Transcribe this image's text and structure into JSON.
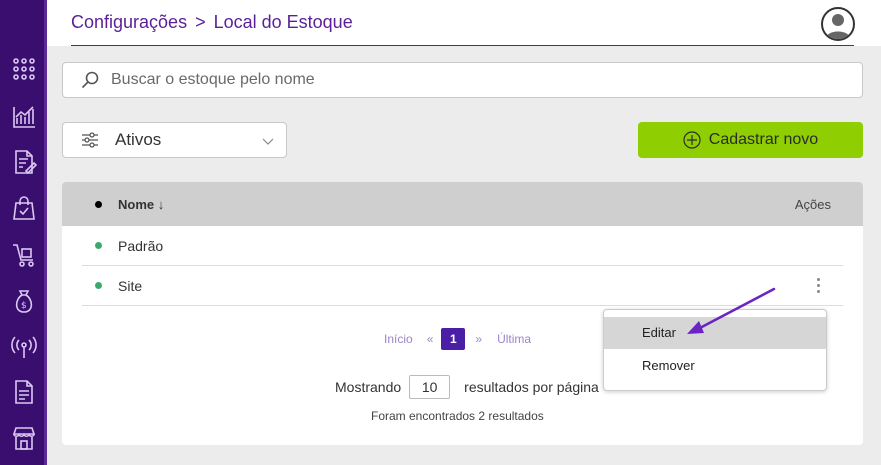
{
  "breadcrumb": {
    "parent": "Configurações",
    "separator": ">",
    "current": "Local do Estoque"
  },
  "search": {
    "placeholder": "Buscar o estoque pelo nome",
    "value": ""
  },
  "filter": {
    "selected": "Ativos"
  },
  "actions": {
    "new_label": "Cadastrar novo"
  },
  "table": {
    "col_name": "Nome",
    "sort_indicator": "↓",
    "col_actions": "Ações",
    "rows": [
      {
        "name": "Padrão",
        "status_color": "#3aaa6f"
      },
      {
        "name": "Site",
        "status_color": "#3aaa6f"
      }
    ]
  },
  "pagination": {
    "first": "Início",
    "prev": "«",
    "current": "1",
    "next": "»",
    "last": "Última"
  },
  "per_page": {
    "prefix": "Mostrando",
    "value": "10",
    "suffix": "resultados por página"
  },
  "results_text": "Foram encontrados 2 resultados",
  "row_menu": {
    "items": [
      "Editar",
      "Remover"
    ]
  },
  "sidebar": {
    "items": [
      "apps-grid-icon",
      "chart-icon",
      "document-edit-icon",
      "shopping-bag-icon",
      "cart-icon",
      "money-bag-icon",
      "broadcast-icon",
      "invoice-icon",
      "storefront-icon"
    ]
  },
  "colors": {
    "sidebar": "#3a0e6e",
    "accent": "#5a1f99",
    "primary_button": "#8fce00",
    "status_active": "#3aaa6f",
    "pagination_active": "#4a1fa6",
    "annotation_arrow": "#6a24c4"
  }
}
